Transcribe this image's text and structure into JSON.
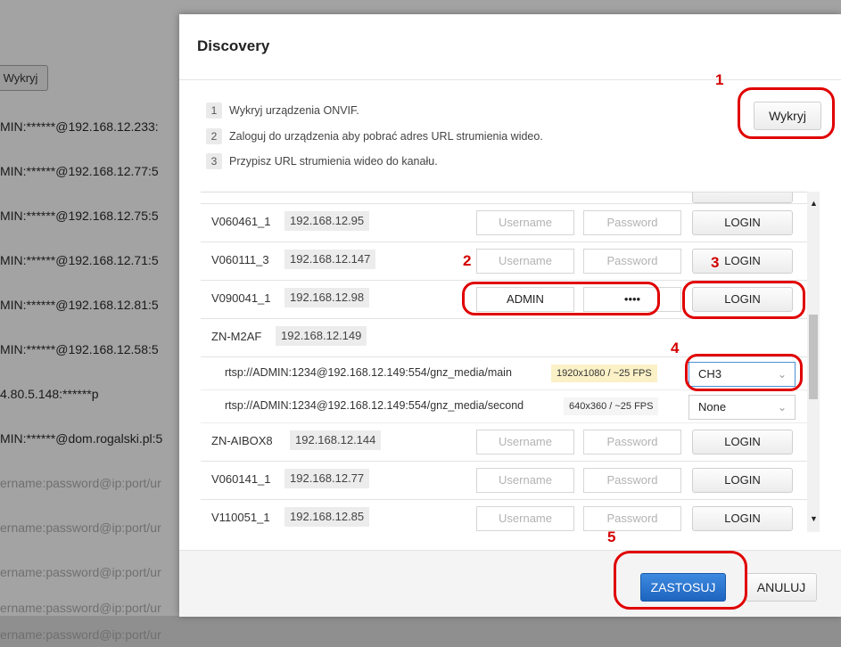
{
  "background": {
    "button_label": "Wykryj",
    "rows": [
      {
        "text": "MIN:******@192.168.12.233:",
        "placeholder": false
      },
      {
        "text": "MIN:******@192.168.12.77:5",
        "placeholder": false
      },
      {
        "text": "MIN:******@192.168.12.75:5",
        "placeholder": false
      },
      {
        "text": "MIN:******@192.168.12.71:5",
        "placeholder": false
      },
      {
        "text": "MIN:******@192.168.12.81:5",
        "placeholder": false
      },
      {
        "text": "MIN:******@192.168.12.58:5",
        "placeholder": false
      },
      {
        "text": "4.80.5.148:******p",
        "placeholder": false
      },
      {
        "text": "MIN:******@dom.rogalski.pl:5",
        "placeholder": false
      },
      {
        "text": "ername:password@ip:port/ur",
        "placeholder": true
      },
      {
        "text": "ername:password@ip:port/ur",
        "placeholder": true
      },
      {
        "text": "ername:password@ip:port/ur",
        "placeholder": true
      },
      {
        "text": "ername:password@ip:port/ur",
        "placeholder": true
      },
      {
        "text": "ername:password@ip:port/ur",
        "placeholder": true
      }
    ]
  },
  "modal": {
    "title": "Discovery",
    "steps": [
      {
        "num": "1",
        "text": "Wykryj urządzenia ONVIF."
      },
      {
        "num": "2",
        "text": "Zaloguj do urządzenia aby pobrać adres URL strumienia wideo."
      },
      {
        "num": "3",
        "text": "Przypisz URL strumienia wideo do kanału."
      }
    ],
    "detect_button": "Wykryj",
    "devices": [
      {
        "name": "V060461_1",
        "ip": "192.168.12.95",
        "username": "Username",
        "password": "Password",
        "login": "LOGIN",
        "filled": false
      },
      {
        "name": "V060111_3",
        "ip": "192.168.12.147",
        "username": "Username",
        "password": "Password",
        "login": "LOGIN",
        "filled": false
      },
      {
        "name": "V090041_1",
        "ip": "192.168.12.98",
        "username": "ADMIN",
        "password": "••••",
        "login": "LOGIN",
        "filled": true
      },
      {
        "name": "ZN-M2AF",
        "ip": "192.168.12.149"
      },
      {
        "name": "ZN-AIBOX8",
        "ip": "192.168.12.144",
        "username": "Username",
        "password": "Password",
        "login": "LOGIN",
        "filled": false
      },
      {
        "name": "V060141_1",
        "ip": "192.168.12.77",
        "username": "Username",
        "password": "Password",
        "login": "LOGIN",
        "filled": false
      },
      {
        "name": "V110051_1",
        "ip": "192.168.12.85",
        "username": "Username",
        "password": "Password",
        "login": "LOGIN",
        "filled": false
      }
    ],
    "streams": [
      {
        "url": "rtsp://ADMIN:1234@192.168.12.149:554/gnz_media/main",
        "resolution": "1920x1080 / ~25 FPS",
        "channel": "CH3"
      },
      {
        "url": "rtsp://ADMIN:1234@192.168.12.149:554/gnz_media/second",
        "resolution": "640x360 / ~25 FPS",
        "channel": "None"
      }
    ],
    "apply_button": "ZASTOSUJ",
    "cancel_button": "ANULUJ"
  },
  "annotations": [
    "1",
    "2",
    "3",
    "4",
    "5"
  ],
  "colors": {
    "annotation": "#e00000",
    "primary": "#1d64bf",
    "resolution_highlight": "#fbf1c7"
  }
}
